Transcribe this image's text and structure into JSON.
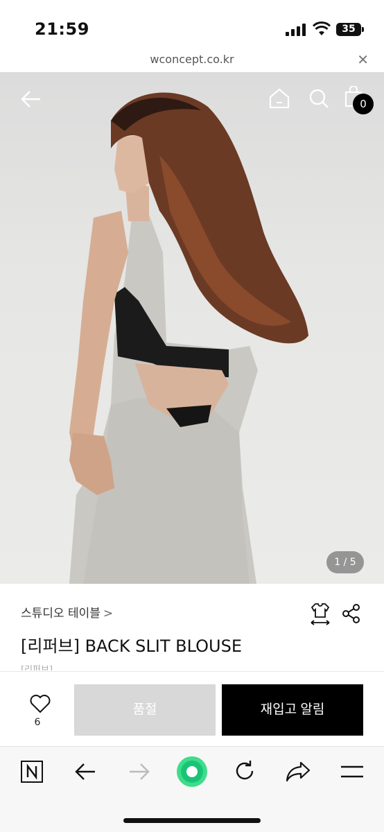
{
  "status_bar": {
    "time": "21:59",
    "battery": "35"
  },
  "browser": {
    "url": "wconcept.co.kr"
  },
  "hero": {
    "cart_count": "0",
    "pager": "1 / 5"
  },
  "product": {
    "brand": "스튜디오 테이블",
    "brand_chevron": ">",
    "title": "[리퍼브] BACK SLIT BLOUSE",
    "subtitle": "[리퍼브]"
  },
  "actions": {
    "like_count": "6",
    "soldout_label": "품절",
    "restock_label": "재입고 알림"
  },
  "colors": {
    "accent_green": "#3fdc8a",
    "primary_button": "#000000",
    "disabled_button": "#d8d8d8"
  }
}
